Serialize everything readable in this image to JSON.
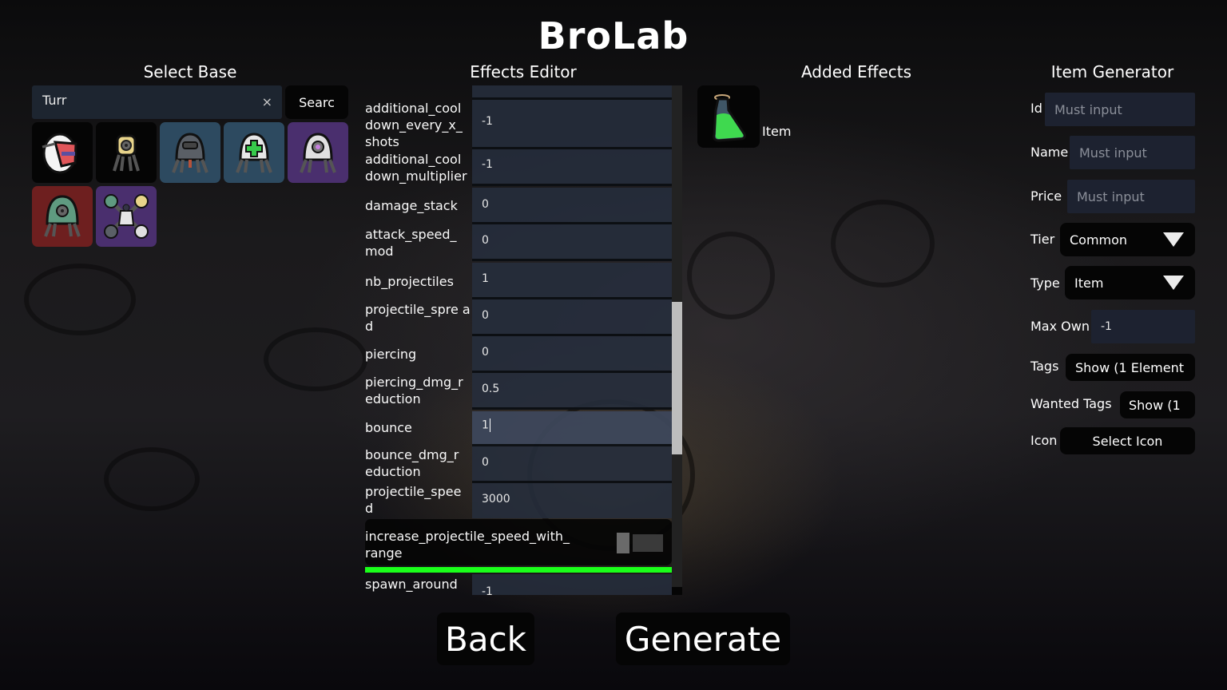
{
  "app": {
    "title": "BroLab"
  },
  "select_base": {
    "heading": "Select Base",
    "search": {
      "value": "Turr",
      "clear_icon": "×",
      "button_label": "Searc"
    },
    "bases": [
      {
        "name": "egg-turret",
        "tier_color": "#050505"
      },
      {
        "name": "yellow-turret",
        "tier_color": "#050505"
      },
      {
        "name": "gray-visor-turret",
        "tier_color": "#2d4a60"
      },
      {
        "name": "healing-turret",
        "tier_color": "#2d4a60"
      },
      {
        "name": "purple-eye-turret",
        "tier_color": "#4a2f6e"
      },
      {
        "name": "green-turret",
        "tier_color": "#6e1f1f"
      },
      {
        "name": "turret-cluster",
        "tier_color": "#4a2f6e"
      }
    ]
  },
  "effects_editor": {
    "heading": "Effects Editor",
    "rows": [
      {
        "label": "additional_cool down_every_x_ shots",
        "value": "-1"
      },
      {
        "label": "additional_cool down_multiplier",
        "value": "-1"
      },
      {
        "label": "damage_stack",
        "value": "0"
      },
      {
        "label": "attack_speed_ mod",
        "value": "0"
      },
      {
        "label": "nb_projectiles",
        "value": "1"
      },
      {
        "label": "projectile_spre ad",
        "value": "0"
      },
      {
        "label": "piercing",
        "value": "0"
      },
      {
        "label": "piercing_dmg_r eduction",
        "value": "0.5"
      },
      {
        "label": "bounce",
        "value": "1",
        "focused": true
      },
      {
        "label": "bounce_dmg_r eduction",
        "value": "0"
      },
      {
        "label": "projectile_spee d",
        "value": "3000"
      }
    ],
    "toggle": {
      "label": "increase_projectile_speed_with_ range",
      "on": false
    },
    "last_row": {
      "label": "spawn_around",
      "value": "-1"
    },
    "scroll": {
      "position_fraction": 0.62
    }
  },
  "added_effects": {
    "heading": "Added Effects",
    "items": [
      {
        "label": "Item",
        "icon": "potion-icon"
      }
    ]
  },
  "item_generator": {
    "heading": "Item Generator",
    "id": {
      "label": "Id",
      "placeholder": "Must input"
    },
    "name": {
      "label": "Name",
      "placeholder": "Must input"
    },
    "price": {
      "label": "Price",
      "placeholder": "Must input"
    },
    "tier": {
      "label": "Tier",
      "selected": "Common"
    },
    "type": {
      "label": "Type",
      "selected": "Item"
    },
    "max_own": {
      "label": "Max Own",
      "value": "-1"
    },
    "tags": {
      "label": "Tags",
      "button": "Show (1 Element"
    },
    "wanted_tags": {
      "label": "Wanted Tags",
      "button": "Show (1"
    },
    "icon": {
      "label": "Icon",
      "button": "Select Icon"
    }
  },
  "actions": {
    "back": "Back",
    "generate": "Generate"
  }
}
